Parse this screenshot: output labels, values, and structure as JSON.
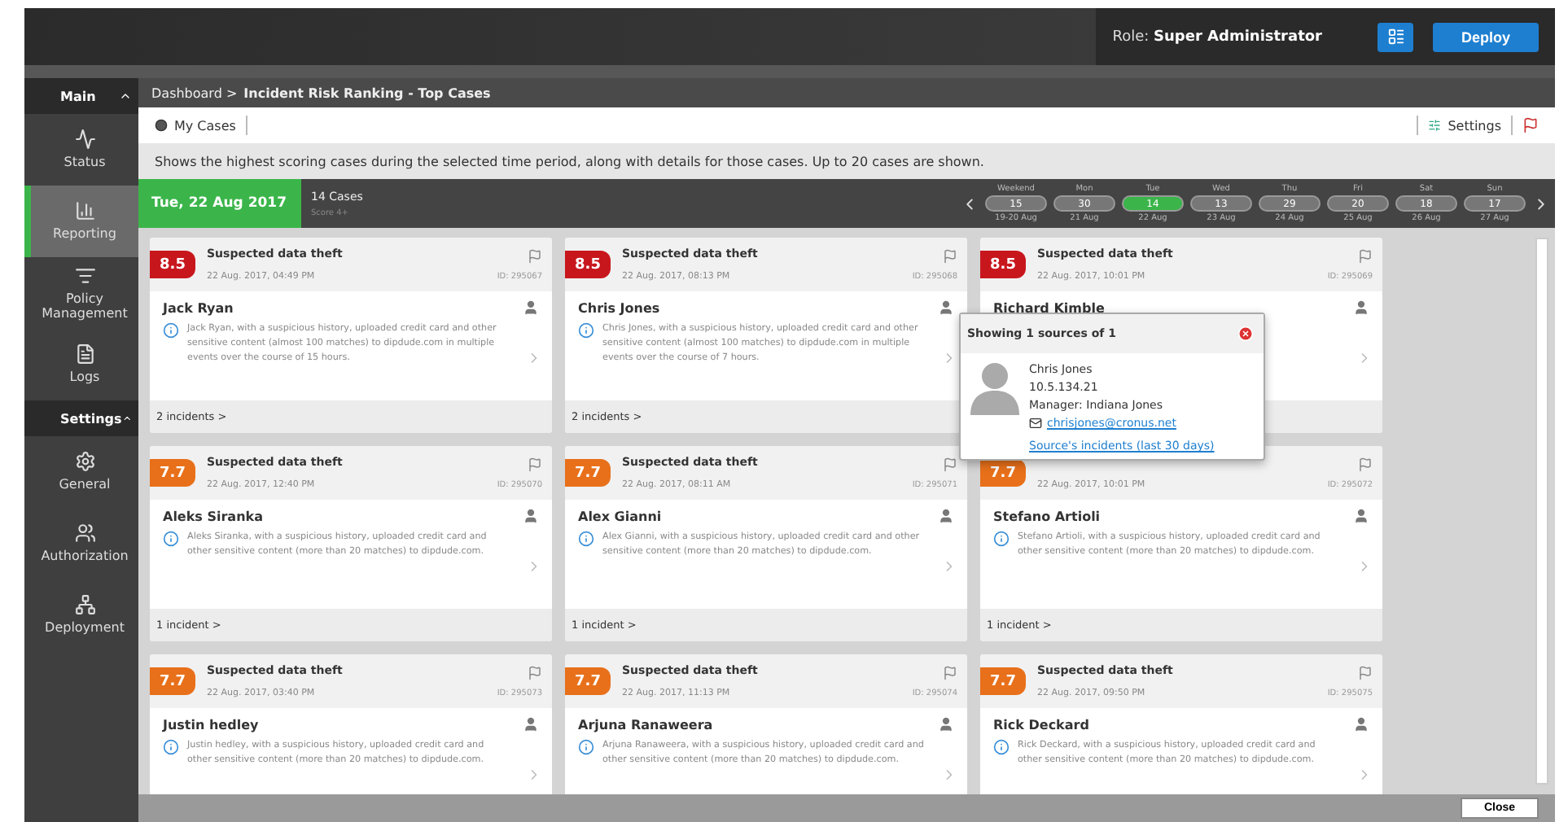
{
  "topbar": {
    "role": "Role: **Super Administrator**",
    "deploy": "Deploy"
  },
  "sidebar": [
    {
      "kind": "header",
      "label": "Main",
      "expanded": true
    },
    {
      "kind": "item",
      "label": "Status",
      "selected": false
    },
    {
      "kind": "item",
      "label": "Reporting",
      "selected": true
    },
    {
      "kind": "item",
      "label": "Policy Management",
      "selected": false
    },
    {
      "kind": "item",
      "label": "Logs",
      "selected": false
    },
    {
      "kind": "header",
      "label": "Settings",
      "expanded": true
    },
    {
      "kind": "item",
      "label": "General",
      "selected": false
    },
    {
      "kind": "item",
      "label": "Authorization",
      "selected": false
    },
    {
      "kind": "item",
      "label": "Deployment",
      "selected": false
    }
  ],
  "breadcrumb": {
    "parent": "Dashboard >",
    "current": "Incident Risk Ranking - Top Cases"
  },
  "toolbar": {
    "my_cases": "My Cases",
    "settings": "Settings"
  },
  "description": "Shows the highest scoring cases during the selected time period, along with details for those cases. Up to 20 cases are shown.",
  "date_bar": {
    "date": "Tue, 22 Aug 2017",
    "cases": "14 Cases",
    "score": "Score 4+"
  },
  "days": [
    {
      "day": "Weekend",
      "count": "15",
      "date": "19-20 Aug",
      "selected": false
    },
    {
      "day": "Mon",
      "count": "30",
      "date": "21 Aug",
      "selected": false
    },
    {
      "day": "Tue",
      "count": "14",
      "date": "22 Aug",
      "selected": true
    },
    {
      "day": "Wed",
      "count": "13",
      "date": "23 Aug",
      "selected": false
    },
    {
      "day": "Thu",
      "count": "29",
      "date": "24 Aug",
      "selected": false
    },
    {
      "day": "Fri",
      "count": "20",
      "date": "25 Aug",
      "selected": false
    },
    {
      "day": "Sat",
      "count": "18",
      "date": "26 Aug",
      "selected": false
    },
    {
      "day": "Sun",
      "count": "17",
      "date": "27 Aug",
      "selected": false
    }
  ],
  "cards": [
    {
      "score": "8.5",
      "color": "#c8161d",
      "type": "Suspected data theft",
      "time": "22 Aug. 2017, 04:49 PM",
      "id": "ID: 295067",
      "name": "Jack Ryan",
      "description": "Jack Ryan, with a suspicious history, uploaded credit card and other sensitive content (almost 100 matches) to dipdude.com in multiple events over the course of 15 hours.",
      "footer": "2 incidents >"
    },
    {
      "score": "8.5",
      "color": "#c8161d",
      "type": "Suspected data theft",
      "time": "22 Aug. 2017, 08:13 PM",
      "id": "ID: 295068",
      "name": "Chris Jones",
      "description": "Chris Jones, with a suspicious history, uploaded credit card and other sensitive content (almost 100 matches) to dipdude.com in multiple events over the course of 7 hours.",
      "footer": "2 incidents >"
    },
    {
      "score": "8.5",
      "color": "#c8161d",
      "type": "Suspected data theft",
      "time": "22 Aug. 2017, 10:01 PM",
      "id": "ID: 295069",
      "name": "Richard Kimble"
    },
    {
      "score": "7.7",
      "color": "#e8701a",
      "type": "Suspected data theft",
      "time": "22 Aug. 2017, 12:40 PM",
      "id": "ID: 295070",
      "name": "Aleks Siranka",
      "description": "Aleks Siranka, with a suspicious history, uploaded credit card and other sensitive content (more than 20 matches) to dipdude.com.",
      "footer": "1 incident >"
    },
    {
      "score": "7.7",
      "color": "#e8701a",
      "type": "Suspected data theft",
      "time": "22 Aug. 2017, 08:11 AM",
      "id": "ID: 295071",
      "name": "Alex Gianni",
      "description": "Alex Gianni, with a suspicious history, uploaded credit card and other sensitive content (more than 20 matches) to dipdude.com.",
      "footer": "1 incident >"
    },
    {
      "score": "7.7",
      "color": "#e8701a",
      "time": "22 Aug. 2017, 10:01 PM",
      "id": "ID: 295072",
      "name": "Stefano Artioli",
      "description": "Stefano Artioli, with a suspicious history, uploaded credit card and other sensitive content (more than 20 matches) to dipdude.com.",
      "footer": "1 incident >"
    },
    {
      "score": "7.7",
      "color": "#e8701a",
      "type": "Suspected data theft",
      "time": "22 Aug. 2017, 03:40 PM",
      "id": "ID: 295073",
      "name": "Justin hedley",
      "description": "Justin hedley, with a suspicious history, uploaded credit card and other sensitive content (more than 20 matches) to dipdude.com."
    },
    {
      "score": "7.7",
      "color": "#e8701a",
      "type": "Suspected data theft",
      "time": "22 Aug. 2017, 11:13 PM",
      "id": "ID: 295074",
      "name": "Arjuna Ranaweera",
      "description": "Arjuna Ranaweera, with a suspicious history, uploaded credit card and other sensitive content (more than 20 matches) to dipdude.com."
    },
    {
      "score": "7.7",
      "color": "#e8701a",
      "type": "Suspected data theft",
      "time": "22 Aug. 2017, 09:50 PM",
      "id": "ID: 295075",
      "name": "Rick Deckard",
      "description": "Rick Deckard, with a suspicious history, uploaded credit card and other sensitive content (more than 20 matches) to dipdude.com."
    }
  ],
  "popup": {
    "title": "Showing 1 sources of 1",
    "name": "Chris Jones",
    "ip": "10.5.134.21",
    "manager": "Manager: Indiana Jones",
    "email": "chrisjones@cronus.net",
    "link": "Source's incidents (last 30 days)"
  },
  "close": "Close"
}
